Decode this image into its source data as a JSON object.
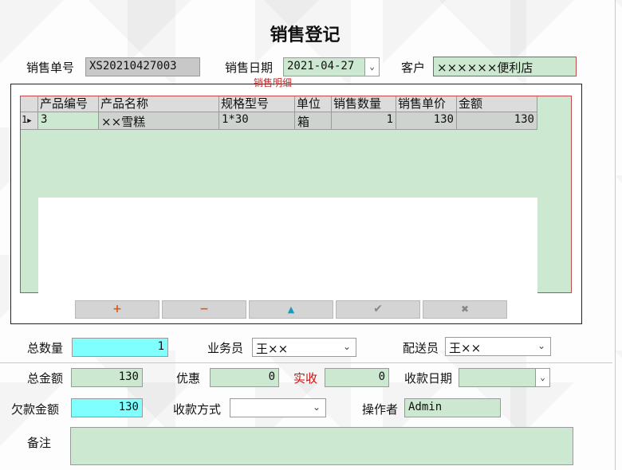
{
  "title": "销售登记",
  "header": {
    "order_no_label": "销售单号",
    "order_no": "XS20210427003",
    "date_label": "销售日期",
    "date": "2021-04-27",
    "customer_label": "客户",
    "customer": "××××××便利店"
  },
  "details_caption": "销售明细",
  "grid": {
    "columns": [
      "产品编号",
      "产品名称",
      "规格型号",
      "单位",
      "销售数量",
      "销售单价",
      "金额"
    ],
    "rows": [
      {
        "indicator": "1",
        "code": "3",
        "name": "××雪糕",
        "spec": "1*30",
        "unit": "箱",
        "qty": "1",
        "price": "130",
        "amount": "130"
      }
    ]
  },
  "toolbar": {
    "add": "+",
    "remove": "−",
    "up": "▲",
    "confirm": "✔",
    "cancel": "✖"
  },
  "summary": {
    "total_qty_label": "总数量",
    "total_qty": "1",
    "salesman_label": "业务员",
    "salesman": "王××",
    "delivery_label": "配送员",
    "delivery": "王××",
    "total_amount_label": "总金额",
    "total_amount": "130",
    "discount_label": "优惠",
    "discount": "0",
    "received_label": "实收",
    "received": "0",
    "receipt_date_label": "收款日期",
    "receipt_date": "",
    "owed_label": "欠款金额",
    "owed": "130",
    "pay_method_label": "收款方式",
    "pay_method": "",
    "operator_label": "操作者",
    "operator": "Admin",
    "remark_label": "备注",
    "remark": ""
  },
  "colors": {
    "field_green": "#cce8d0",
    "field_cyan": "#80ffff",
    "received_red": "#d01010",
    "grid_border": "#c24a4a"
  }
}
